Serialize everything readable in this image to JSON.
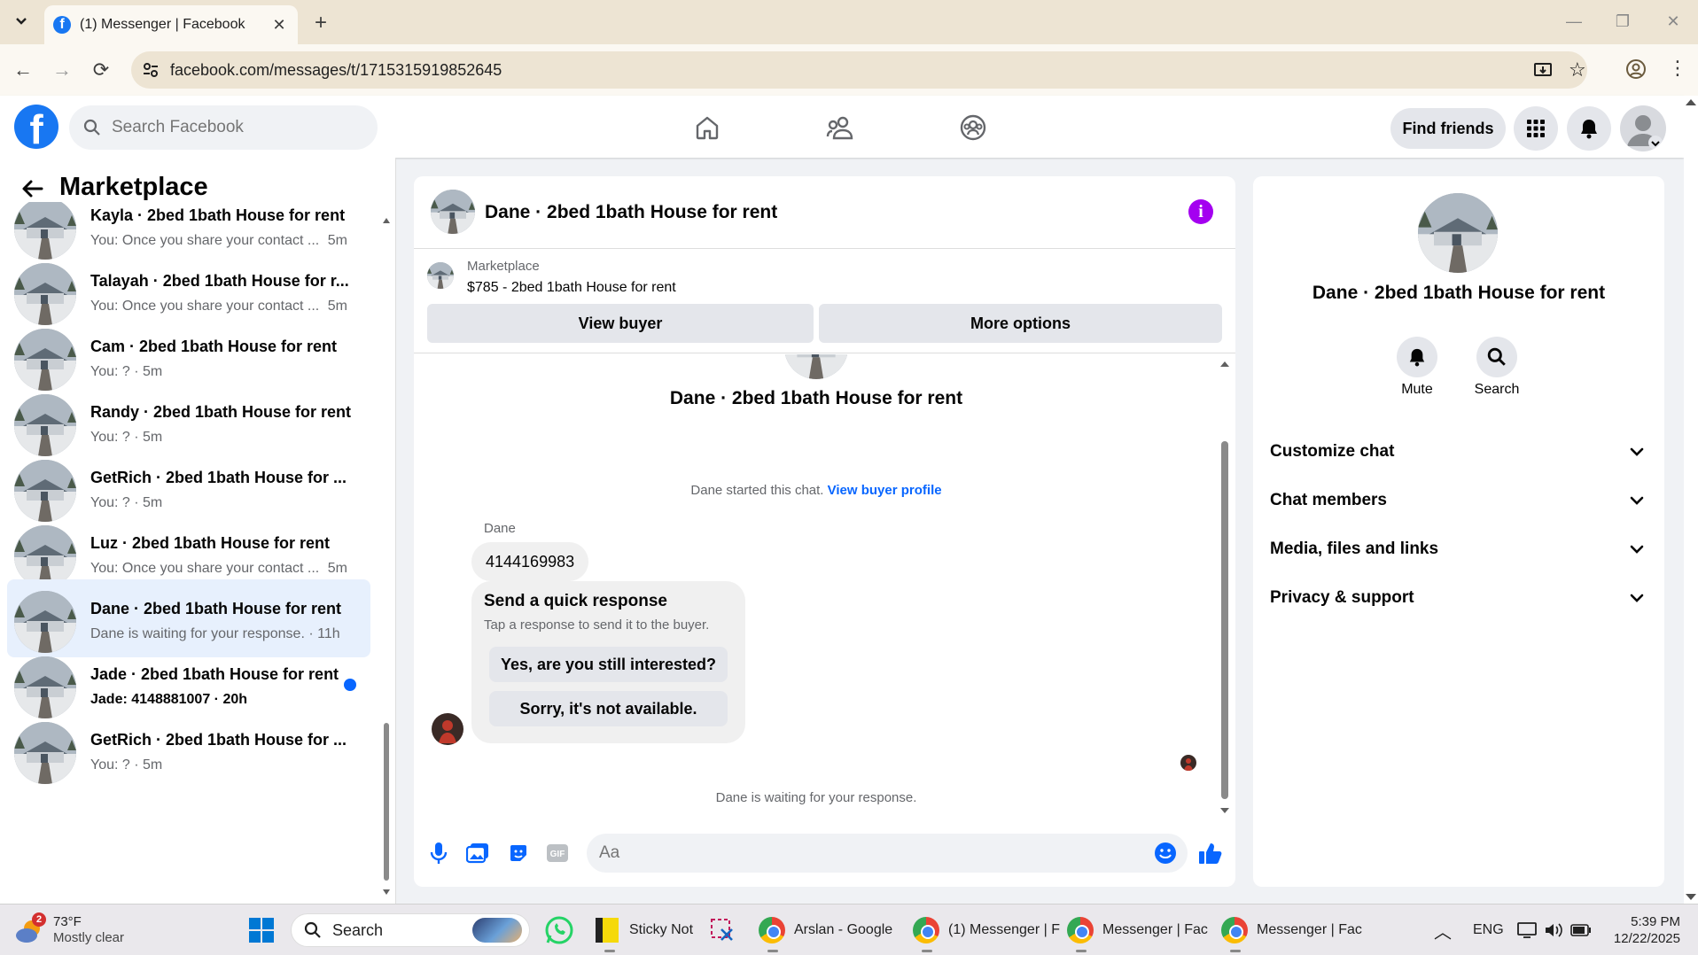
{
  "browser": {
    "tab_title": "(1) Messenger | Facebook",
    "url": "facebook.com/messages/t/1715315919852645"
  },
  "header": {
    "search_placeholder": "Search Facebook",
    "find_friends": "Find friends"
  },
  "sidebar": {
    "title": "Marketplace",
    "conversations": [
      {
        "name": "Kayla · 2bed 1bath House for rent",
        "snippet": "You: Once you share your contact ...",
        "time": "5m",
        "active": false,
        "unread": false
      },
      {
        "name": "Talayah · 2bed 1bath House for r...",
        "snippet": "You: Once you share your contact ...",
        "time": "5m",
        "active": false,
        "unread": false
      },
      {
        "name": "Cam · 2bed 1bath House for rent",
        "snippet": "You: ? · 5m",
        "time": "",
        "active": false,
        "unread": false
      },
      {
        "name": "Randy · 2bed 1bath House for rent",
        "snippet": "You: ? · 5m",
        "time": "",
        "active": false,
        "unread": false
      },
      {
        "name": "GetRich · 2bed 1bath House for ...",
        "snippet": "You: ? · 5m",
        "time": "",
        "active": false,
        "unread": false
      },
      {
        "name": "Luz · 2bed 1bath House for rent",
        "snippet": "You: Once you share your contact ...",
        "time": "5m",
        "active": false,
        "unread": false
      },
      {
        "name": "Dane · 2bed 1bath House for rent",
        "snippet": "Dane is waiting for your response. · 11h",
        "time": "",
        "active": true,
        "unread": false
      },
      {
        "name": "Jade · 2bed 1bath House for rent",
        "snippet": "Jade: 4148881007 · 20h",
        "time": "",
        "active": false,
        "unread": true
      },
      {
        "name": "GetRich · 2bed 1bath House for ...",
        "snippet": "You: ? · 5m",
        "time": "",
        "active": false,
        "unread": false
      }
    ]
  },
  "chat": {
    "title": "Dane · 2bed 1bath House for rent",
    "marketplace_label": "Marketplace",
    "listing": "$785 - 2bed 1bath House for rent",
    "view_buyer": "View buyer",
    "more_options": "More options",
    "big_name": "Dane · 2bed 1bath House for rent",
    "started_text": "Dane started this chat.",
    "view_buyer_profile": "View buyer profile",
    "sender": "Dane",
    "phone_message": "4144169983",
    "quick_title": "Send a quick response",
    "quick_sub": "Tap a response to send it to the buyer.",
    "quick_1": "Yes, are you still interested?",
    "quick_2": "Sorry, it's not available.",
    "waiting": "Dane is waiting for your response.",
    "input_placeholder": "Aa"
  },
  "right_panel": {
    "name": "Dane · 2bed 1bath House for rent",
    "mute": "Mute",
    "search": "Search",
    "sections": [
      "Customize chat",
      "Chat members",
      "Media, files and links",
      "Privacy & support"
    ]
  },
  "taskbar": {
    "weather_temp": "73°F",
    "weather_desc": "Mostly clear",
    "weather_badge": "2",
    "search": "Search",
    "sticky": "Sticky Not",
    "app1": "Arslan - Google",
    "app2": "(1) Messenger | F",
    "app3": "Messenger | Fac",
    "app4": "Messenger | Fac",
    "lang": "ENG",
    "time": "5:39 PM",
    "date": "12/22/2025"
  },
  "colors": {
    "brand": "#1877f2",
    "active_row": "#e7f0fd",
    "info": "#a400f0",
    "link": "#0866ff"
  }
}
